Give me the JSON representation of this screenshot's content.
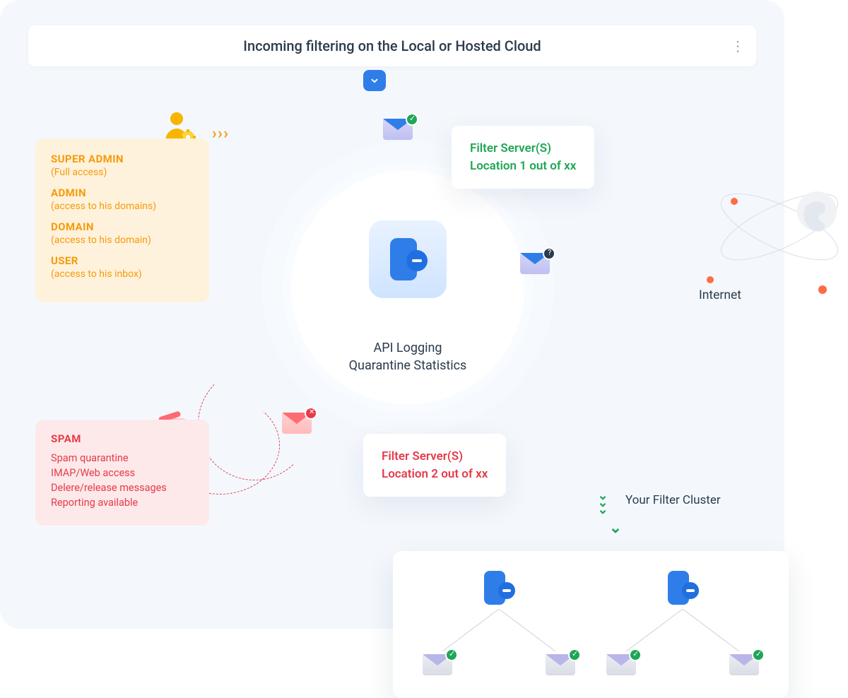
{
  "header": {
    "title": "Incoming filtering on the Local or Hosted Cloud"
  },
  "roles": {
    "super_admin_title": "SUPER ADMIN",
    "super_admin_sub": "(Full access)",
    "admin_title": "ADMIN",
    "admin_sub": "(access to his domains)",
    "domain_title": "DOMAIN",
    "domain_sub": "(access to his domain)",
    "user_title": "USER",
    "user_sub": "(access to his inbox)"
  },
  "spam": {
    "title": "SPAM",
    "item1": "Spam quarantine",
    "item2": "IMAP/Web access",
    "item3": "Delere/release messages",
    "item4": "Reporting available"
  },
  "api": {
    "line1": "API Logging",
    "line2": "Quarantine Statistics"
  },
  "filter1": {
    "line1": "Filter Server(S)",
    "line2": "Location 1 out of xx"
  },
  "filter2": {
    "line1": "Filter Server(S)",
    "line2": "Location 2 out of xx"
  },
  "labels": {
    "cluster": "Your Filter Cluster",
    "internet": "Internet"
  },
  "colors": {
    "orange": "#f59b0b",
    "red": "#e63b4a",
    "green": "#1fa656",
    "blue": "#2f7de8"
  }
}
